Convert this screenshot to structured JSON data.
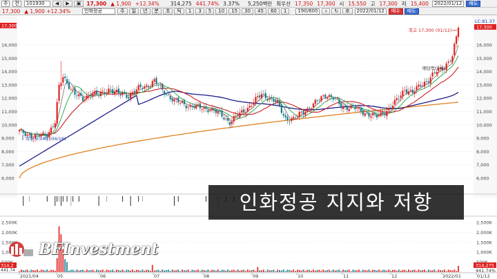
{
  "toolbar": {
    "code_label": "주",
    "code_mode": "전",
    "code_value": "101930",
    "nav_buttons": [
      "◀",
      "▶",
      "▣"
    ],
    "price": "17,300",
    "change": "▲ 1,900",
    "change_pct": "+12.34%",
    "volume": "314,275",
    "volume_pct": "441.74%",
    "turnover": "3.37%",
    "amount": "5,250백만",
    "open_label": "최우선",
    "open_value": "17,350",
    "bid_value": "17,300",
    "low_label": "시",
    "low_value": "15,550",
    "high_label": "고",
    "high_value": "17,300",
    "close_label": "저",
    "close_value": "15,400",
    "date": "2022/01/12",
    "sell_btn": "매도"
  },
  "toolbar_row2": {
    "price_box": "17,300",
    "change_small": "▲ 1,900 +12.34%",
    "stock_name": "인화정공",
    "periods": [
      "주",
      "일",
      "년",
      "분",
      "초",
      "틱"
    ],
    "intervals": [
      "1",
      "3",
      "5",
      "10",
      "15",
      "30",
      "45",
      "60",
      "1"
    ],
    "count": "190/600",
    "date2": "2022/01/12",
    "buy_btn": "매수",
    "sell_btn2": "매도"
  },
  "chart_data": {
    "type": "candlestick",
    "price_axis": [
      "17,300",
      "16,000",
      "15,000",
      "14,000",
      "13,000",
      "12,000",
      "11,000",
      "10,000",
      "9,000",
      "8,000",
      "7,000",
      "6,000"
    ],
    "left_axis_top": "17,300",
    "right_axis_top": "LC:81.37",
    "right_price_box": "17,300",
    "x_labels": [
      "2021/04",
      "05",
      "06",
      "07",
      "08",
      "09",
      "10",
      "11",
      "12",
      "2022/01",
      "01/12"
    ],
    "annotation_high": "최고 17,300 (01/12)",
    "annotation_low": "최저 9,040 (04/16)",
    "annotation_dividend": "배당락(0.0)",
    "volume_axis": [
      "2,500K",
      "2,000K",
      "1,500K",
      "1,000K",
      "500K"
    ],
    "volume_axis_right": [
      "2,500K",
      "2,000K",
      "1,500K",
      "1,000K",
      "500K"
    ],
    "volume_box": "314,275",
    "volume_pct_box": "441.74%",
    "volume_left_box": "314,2",
    "volume_left_pct": "441.74",
    "colors": {
      "up": "#e02020",
      "down": "#1a7a8a",
      "ma5": "#555555",
      "ma20": "#cc2020",
      "ma60": "#1a1a8a",
      "ma120": "#e08020",
      "ma_green": "#20a040"
    }
  },
  "caption": "인화정공 지지와 저항",
  "watermark": {
    "text": "BFInvestment"
  }
}
